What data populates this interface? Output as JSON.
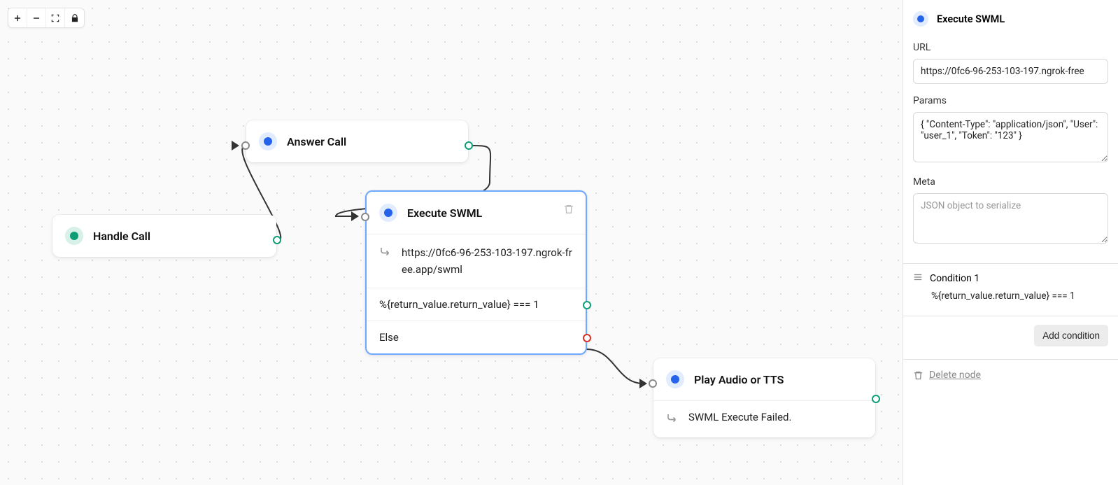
{
  "toolbar": {
    "zoom_in": "plus-icon",
    "zoom_out": "minus-icon",
    "fit": "fit-icon",
    "lock": "lock-icon"
  },
  "nodes": {
    "handle_call": {
      "title": "Handle Call"
    },
    "answer_call": {
      "title": "Answer Call"
    },
    "execute_swml": {
      "title": "Execute SWML",
      "url": "https://0fc6-96-253-103-197.ngrok-free.app/swml",
      "cond": "%{return_value.return_value} === 1",
      "else_label": "Else"
    },
    "play_audio": {
      "title": "Play Audio or TTS",
      "text": "SWML Execute Failed."
    }
  },
  "sidebar": {
    "title": "Execute SWML",
    "url_label": "URL",
    "url_value": "https://0fc6-96-253-103-197.ngrok-free",
    "params_label": "Params",
    "params_value": "{ \"Content-Type\": \"application/json\", \"User\": \"user_1\", \"Token\": \"123\" }",
    "meta_label": "Meta",
    "meta_placeholder": "JSON object to serialize",
    "condition_label": "Condition 1",
    "condition_expr": "%{return_value.return_value} === 1",
    "add_condition": "Add condition",
    "delete_node": "Delete node"
  }
}
